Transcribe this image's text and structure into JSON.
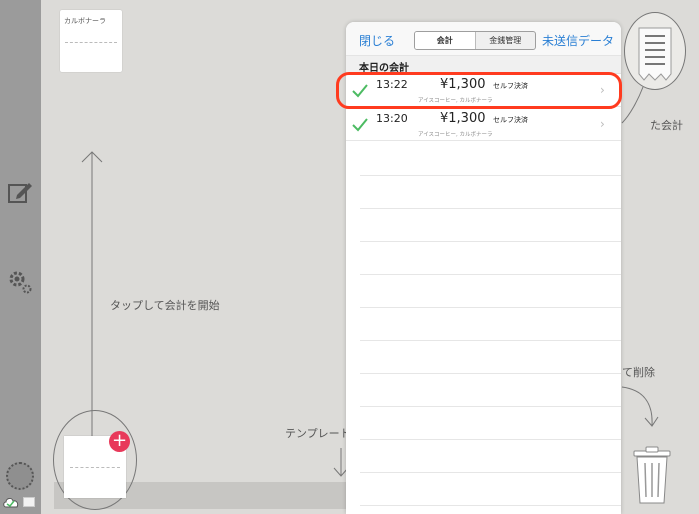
{
  "template": {
    "card_label": "カルボナーラ"
  },
  "hints": {
    "start": "タップして会計を開始",
    "template": "テンプレート",
    "kaikei_partial": "た会計",
    "delete_partial": "て削除"
  },
  "popover": {
    "close_label": "閉じる",
    "tabs": [
      {
        "label": "会計",
        "active": true
      },
      {
        "label": "金銭管理",
        "active": false
      }
    ],
    "unsent_label": "未送信データ",
    "section_title": "本日の会計",
    "transactions": [
      {
        "time": "13:22",
        "amount": "¥1,300",
        "payment": "セルフ決済",
        "items": "アイスコーヒー, カルボナーラ"
      },
      {
        "time": "13:20",
        "amount": "¥1,300",
        "payment": "セルフ決済",
        "items": "アイスコーヒー, カルボナーラ"
      }
    ]
  },
  "colors": {
    "accent_blue": "#2a7fd4",
    "check_green": "#4cbb62",
    "highlight_red": "#ff3b1f",
    "plus_badge": "#e8395a"
  }
}
